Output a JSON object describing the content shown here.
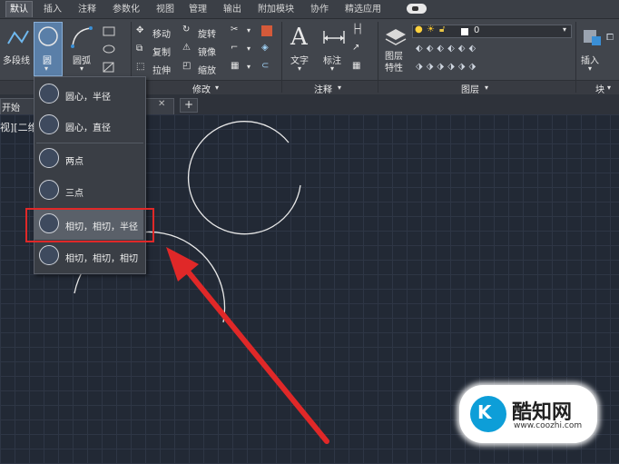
{
  "ribbon_tabs": [
    {
      "label": "默认",
      "active": true
    },
    {
      "label": "插入"
    },
    {
      "label": "注释"
    },
    {
      "label": "参数化"
    },
    {
      "label": "视图"
    },
    {
      "label": "管理"
    },
    {
      "label": "输出"
    },
    {
      "label": "附加模块"
    },
    {
      "label": "协作"
    },
    {
      "label": "精选应用"
    }
  ],
  "draw_panel": {
    "polyline_label": "多段线",
    "circle_label": "圆",
    "arc_label": "圆弧"
  },
  "modify_panel": {
    "title": "修改",
    "move": "移动",
    "rotate": "旋转",
    "copy": "复制",
    "mirror": "镜像",
    "stretch": "拉伸",
    "scale": "缩放"
  },
  "annotation_panel": {
    "title": "注释",
    "text": "文字",
    "dimension": "标注"
  },
  "layers_panel": {
    "title": "图层",
    "layer_properties": "图层\n特性",
    "current_layer": "0"
  },
  "block_panel": {
    "title": "块",
    "insert": "插入"
  },
  "file_tab": {
    "label": "开始"
  },
  "viewport_label": "视][二维",
  "circle_dropdown": {
    "items": [
      {
        "label": "圆心，半径"
      },
      {
        "label": "圆心，直径"
      },
      {
        "label": "两点"
      },
      {
        "label": "三点"
      },
      {
        "label": "相切，相切，半径",
        "highlighted": true
      },
      {
        "label": "相切，相切，相切"
      }
    ]
  },
  "watermark": {
    "brand": "酷知网",
    "url": "www.coozhi.com"
  },
  "colors": {
    "annotation_red": "#e02828",
    "accent_blue": "#1e90d8",
    "canvas_bg": "#222935"
  }
}
